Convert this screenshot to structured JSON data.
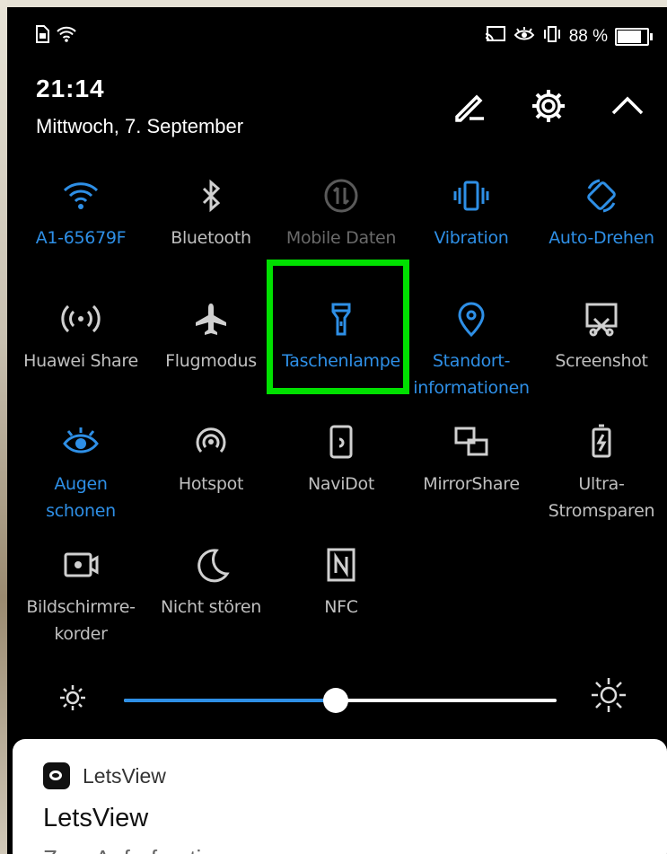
{
  "status_bar": {
    "battery": "88 %",
    "battery_level": 0.88,
    "left_icons": [
      "sim-icon",
      "wifi-icon"
    ],
    "right_icons": [
      "cast-icon",
      "eye-icon",
      "vibrate-icon"
    ]
  },
  "header": {
    "time": "21:14",
    "date": "Mittwoch, 7. September",
    "icons": [
      "edit-icon",
      "gear-icon",
      "chevron-up-icon"
    ]
  },
  "tiles": [
    {
      "label": "A1-65679F",
      "icon": "wifi-icon",
      "state": "on"
    },
    {
      "label": "Bluetooth",
      "icon": "bluetooth-icon",
      "state": "off"
    },
    {
      "label": "Mobile Daten",
      "icon": "mobile-data-icon",
      "state": "disabled"
    },
    {
      "label": "Vibration",
      "icon": "vibration-icon",
      "state": "on"
    },
    {
      "label": "Auto-Drehen",
      "icon": "rotate-icon",
      "state": "on"
    },
    {
      "label": "Huawei Share",
      "icon": "share-icon",
      "state": "off"
    },
    {
      "label": "Flugmodus",
      "icon": "airplane-icon",
      "state": "off"
    },
    {
      "label": "Taschenlampe",
      "icon": "flashlight-icon",
      "state": "on"
    },
    {
      "label_line1": "Standort-",
      "label_line2": "informationen",
      "icon": "location-icon",
      "state": "on"
    },
    {
      "label": "Screenshot",
      "icon": "screenshot-icon",
      "state": "off"
    },
    {
      "label_line1": "Augen",
      "label_line2": "schonen",
      "icon": "eye-icon",
      "state": "on"
    },
    {
      "label": "Hotspot",
      "icon": "hotspot-icon",
      "state": "off"
    },
    {
      "label": "NaviDot",
      "icon": "navidot-icon",
      "state": "off"
    },
    {
      "label": "MirrorShare",
      "icon": "mirrorshare-icon",
      "state": "off"
    },
    {
      "label_line1": "Ultra-",
      "label_line2": "Stromsparen",
      "icon": "battery-saver-icon",
      "state": "off"
    },
    {
      "label_line1": "Bildschirmre-",
      "label_line2": "korder",
      "icon": "screen-recorder-icon",
      "state": "off"
    },
    {
      "label": "Nicht stören",
      "icon": "moon-icon",
      "state": "off"
    },
    {
      "label": "NFC",
      "icon": "nfc-icon",
      "state": "off"
    }
  ],
  "brightness": {
    "level": 0.49
  },
  "notification": {
    "app_name": "LetsView",
    "title": "LetsView",
    "text": "Zum Aufrufen tippen"
  },
  "colors": {
    "accent": "#2e8fe6",
    "highlight": "#00e000",
    "panel": "#000000"
  }
}
